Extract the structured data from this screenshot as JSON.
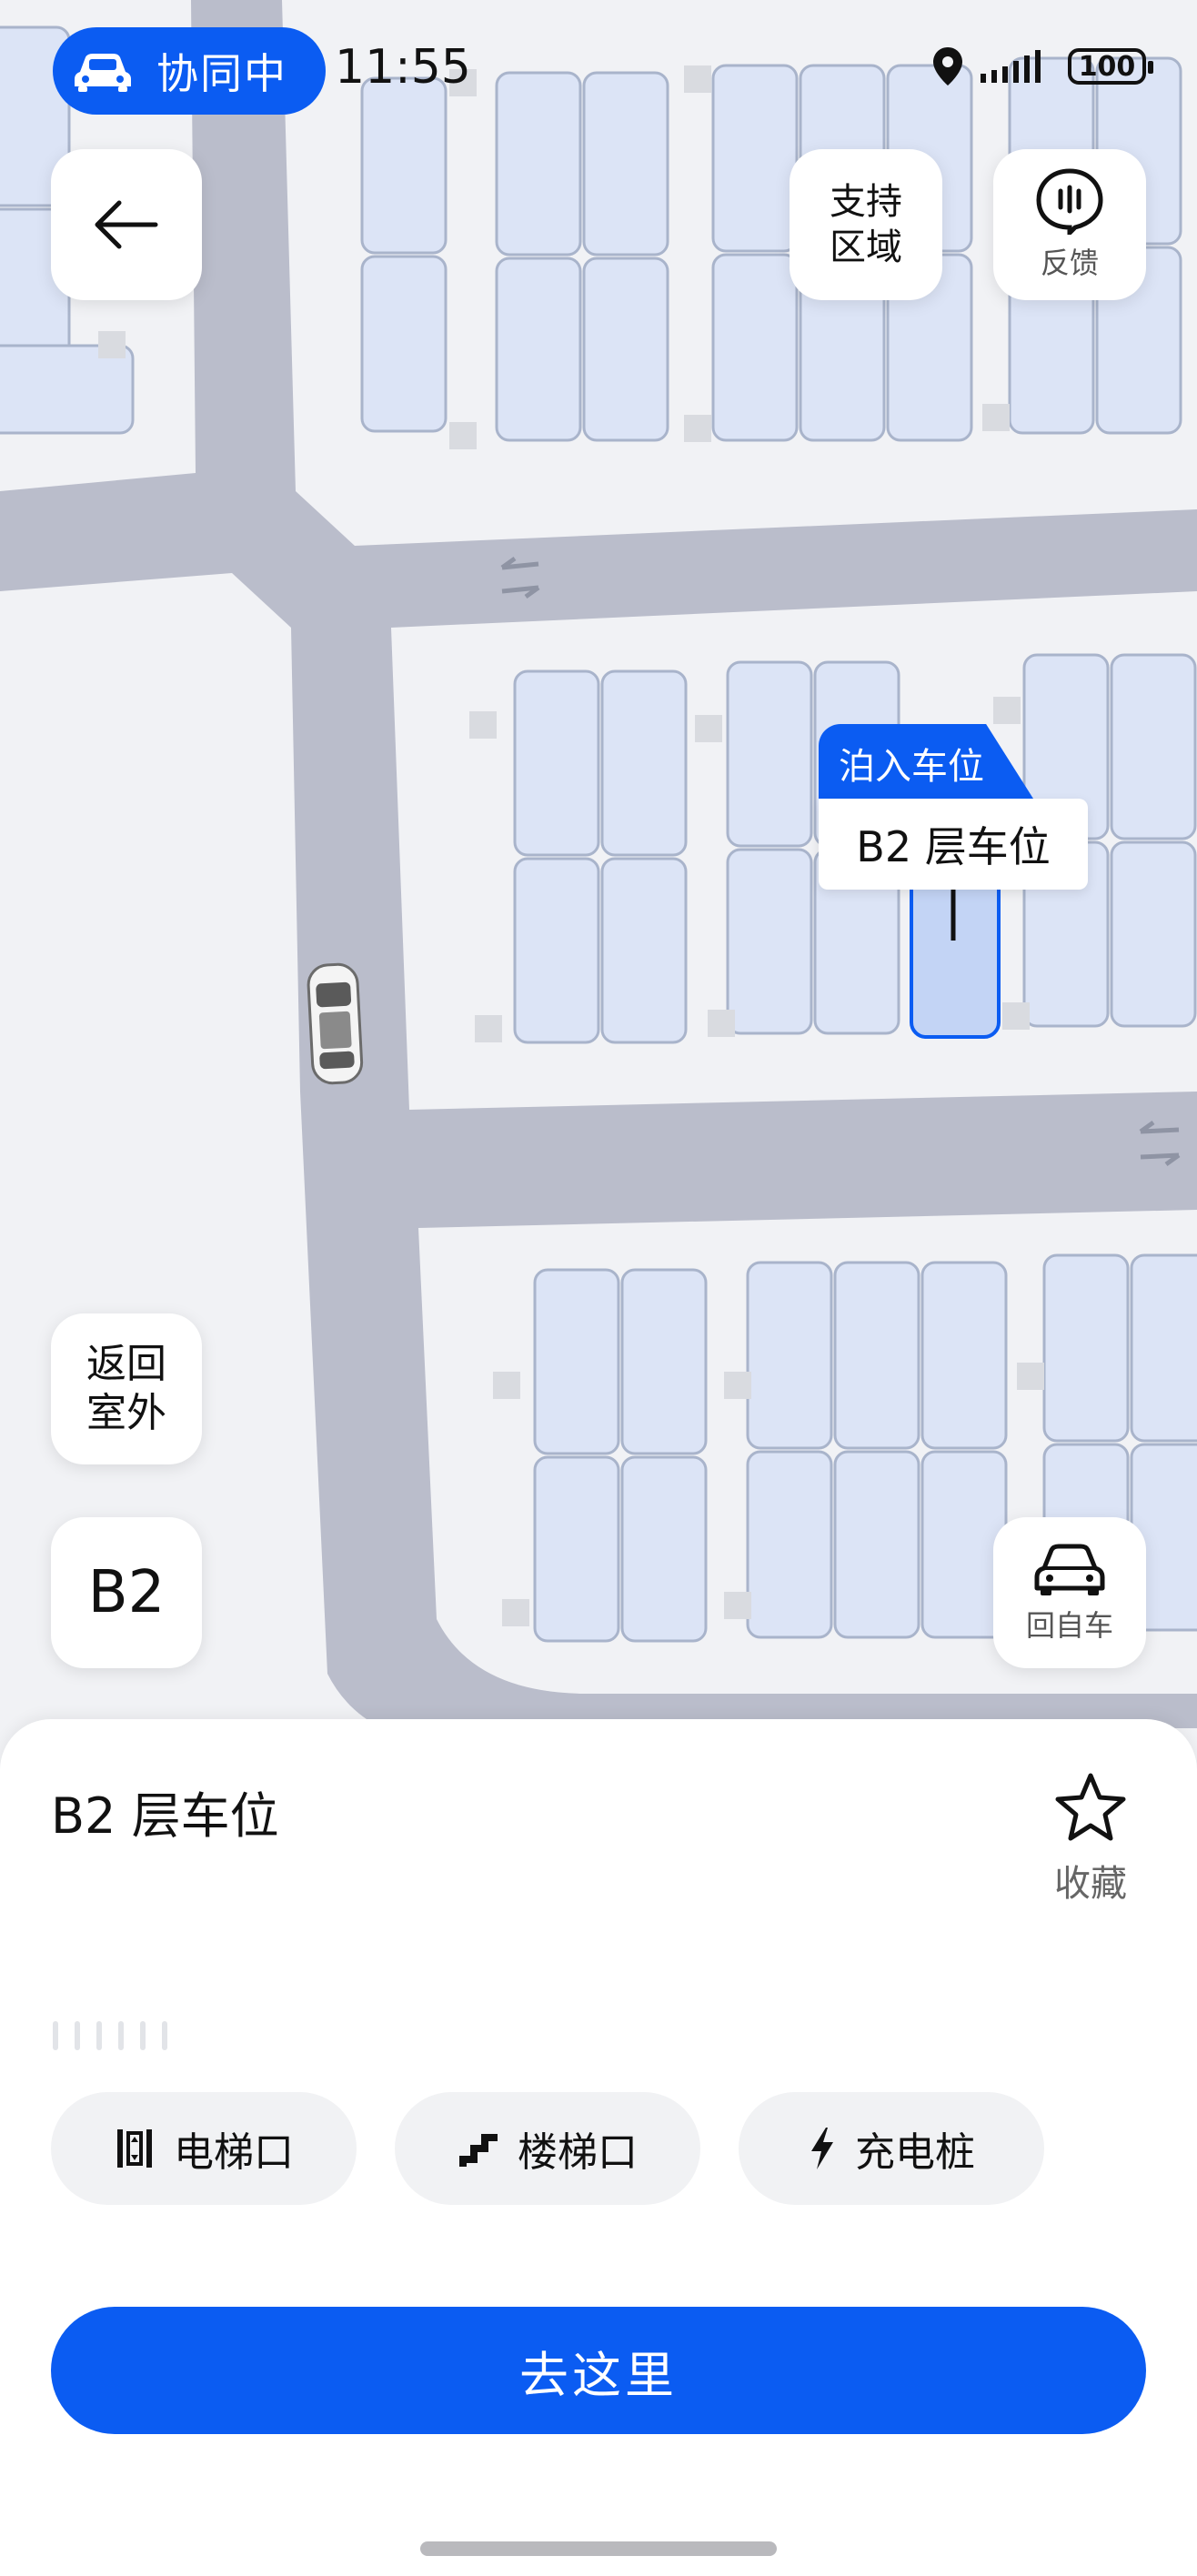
{
  "status_bar": {
    "collab_label": "协同中",
    "time": "11:55",
    "battery": "100"
  },
  "map": {
    "support_area_line1": "支持",
    "support_area_line2": "区域",
    "feedback_label": "反馈",
    "return_outdoor_line1": "返回",
    "return_outdoor_line2": "室外",
    "floor_label": "B2",
    "my_car_label": "回自车",
    "park_in_tag": "泊入车位",
    "spot_label": "B2 层车位"
  },
  "sheet": {
    "title": "B2 层车位",
    "favorite_label": "收藏",
    "chips": [
      {
        "label": "电梯口",
        "icon": "elevator-icon"
      },
      {
        "label": "楼梯口",
        "icon": "stairs-icon"
      },
      {
        "label": "充电桩",
        "icon": "charging-icon"
      }
    ],
    "go_button": "去这里"
  },
  "colors": {
    "accent": "#0b5cf2",
    "road": "#babdcb",
    "spot_fill": "#dce4f6",
    "spot_stroke": "#a9b4cb",
    "selected_spot": "#c3d4f5"
  }
}
